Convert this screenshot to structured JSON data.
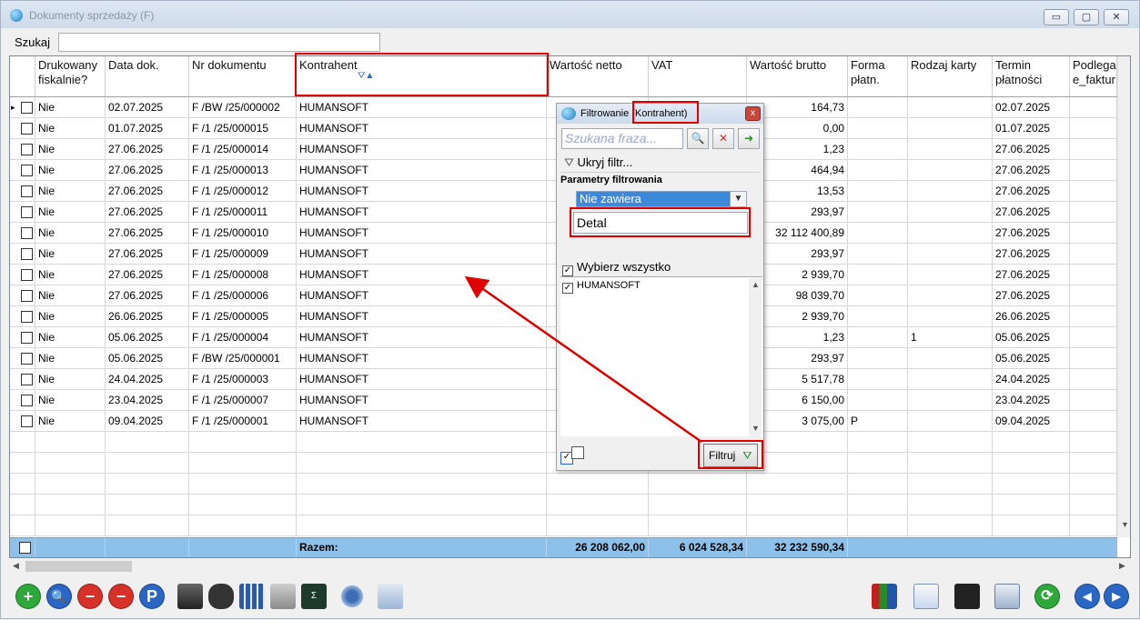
{
  "window": {
    "title": "Dokumenty sprzedaży (F)",
    "controls": {
      "minimize": "▭",
      "maximize": "▢",
      "close": "✕"
    }
  },
  "search": {
    "label": "Szukaj",
    "value": ""
  },
  "columns": [
    {
      "key": "drukowany",
      "label": "Drukowany\nfiskalnie?"
    },
    {
      "key": "data",
      "label": "Data dok."
    },
    {
      "key": "nr",
      "label": "Nr dokumentu"
    },
    {
      "key": "kontrahent",
      "label": "Kontrahent"
    },
    {
      "key": "netto",
      "label": "Wartość netto"
    },
    {
      "key": "vat",
      "label": "VAT"
    },
    {
      "key": "brutto",
      "label": "Wartość brutto"
    },
    {
      "key": "forma",
      "label": "Forma\npłatn."
    },
    {
      "key": "karta",
      "label": "Rodzaj karty"
    },
    {
      "key": "termin",
      "label": "Termin\npłatności"
    },
    {
      "key": "podlega",
      "label": "Podlega\ne_faktur"
    }
  ],
  "rows": [
    {
      "drukowany": "Nie",
      "data": "02.07.2025",
      "nr": "F /BW /25/000002",
      "kontrahent": "HUMANSOFT",
      "brutto": "164,73",
      "forma": "",
      "karta": "",
      "termin": "02.07.2025"
    },
    {
      "drukowany": "Nie",
      "data": "01.07.2025",
      "nr": "F /1  /25/000015",
      "kontrahent": "HUMANSOFT",
      "brutto": "0,00",
      "forma": "",
      "karta": "",
      "termin": "01.07.2025"
    },
    {
      "drukowany": "Nie",
      "data": "27.06.2025",
      "nr": "F /1  /25/000014",
      "kontrahent": "HUMANSOFT",
      "brutto": "1,23",
      "forma": "",
      "karta": "",
      "termin": "27.06.2025"
    },
    {
      "drukowany": "Nie",
      "data": "27.06.2025",
      "nr": "F /1  /25/000013",
      "kontrahent": "HUMANSOFT",
      "brutto": "464,94",
      "forma": "",
      "karta": "",
      "termin": "27.06.2025"
    },
    {
      "drukowany": "Nie",
      "data": "27.06.2025",
      "nr": "F /1  /25/000012",
      "kontrahent": "HUMANSOFT",
      "brutto": "13,53",
      "forma": "",
      "karta": "",
      "termin": "27.06.2025"
    },
    {
      "drukowany": "Nie",
      "data": "27.06.2025",
      "nr": "F /1  /25/000011",
      "kontrahent": "HUMANSOFT",
      "brutto": "293,97",
      "forma": "",
      "karta": "",
      "termin": "27.06.2025"
    },
    {
      "drukowany": "Nie",
      "data": "27.06.2025",
      "nr": "F /1  /25/000010",
      "kontrahent": "HUMANSOFT",
      "brutto": "32 112 400,89",
      "forma": "",
      "karta": "",
      "termin": "27.06.2025"
    },
    {
      "drukowany": "Nie",
      "data": "27.06.2025",
      "nr": "F /1  /25/000009",
      "kontrahent": "HUMANSOFT",
      "brutto": "293,97",
      "forma": "",
      "karta": "",
      "termin": "27.06.2025"
    },
    {
      "drukowany": "Nie",
      "data": "27.06.2025",
      "nr": "F /1  /25/000008",
      "kontrahent": "HUMANSOFT",
      "brutto": "2 939,70",
      "forma": "",
      "karta": "",
      "termin": "27.06.2025"
    },
    {
      "drukowany": "Nie",
      "data": "27.06.2025",
      "nr": "F /1  /25/000006",
      "kontrahent": "HUMANSOFT",
      "brutto": "98 039,70",
      "forma": "",
      "karta": "",
      "termin": "27.06.2025"
    },
    {
      "drukowany": "Nie",
      "data": "26.06.2025",
      "nr": "F /1  /25/000005",
      "kontrahent": "HUMANSOFT",
      "brutto": "2 939,70",
      "forma": "",
      "karta": "",
      "termin": "26.06.2025"
    },
    {
      "drukowany": "Nie",
      "data": "05.06.2025",
      "nr": "F /1  /25/000004",
      "kontrahent": "HUMANSOFT",
      "brutto": "1,23",
      "forma": "",
      "karta": "1",
      "termin": "05.06.2025"
    },
    {
      "drukowany": "Nie",
      "data": "05.06.2025",
      "nr": "F /BW /25/000001",
      "kontrahent": "HUMANSOFT",
      "brutto": "293,97",
      "forma": "",
      "karta": "",
      "termin": "05.06.2025"
    },
    {
      "drukowany": "Nie",
      "data": "24.04.2025",
      "nr": "F /1  /25/000003",
      "kontrahent": "HUMANSOFT",
      "brutto": "5 517,78",
      "forma": "",
      "karta": "",
      "termin": "24.04.2025"
    },
    {
      "drukowany": "Nie",
      "data": "23.04.2025",
      "nr": "F /1  /25/000007",
      "kontrahent": "HUMANSOFT",
      "brutto": "6 150,00",
      "forma": "",
      "karta": "",
      "termin": "23.04.2025"
    },
    {
      "drukowany": "Nie",
      "data": "09.04.2025",
      "nr": "F /1  /25/000001",
      "kontrahent": "HUMANSOFT",
      "brutto": "3 075,00",
      "forma": "P",
      "karta": "",
      "termin": "09.04.2025"
    }
  ],
  "totals": {
    "label": "Razem:",
    "netto": "26 208 062,00",
    "vat": "6 024 528,34",
    "brutto": "32 232 590,34"
  },
  "dialog": {
    "title": "Filtrowanie (Kontrahent)",
    "close": "x",
    "search_placeholder": "Szukana fraza...",
    "hide_filter": "Ukryj filtr...",
    "params_label": "Parametry filtrowania",
    "condition": "Nie zawiera",
    "value": "Detal",
    "select_all": "Wybierz wszystko",
    "items": [
      "HUMANSOFT"
    ],
    "apply_button": "Filtruj"
  },
  "colors": {
    "accent": "#3d89d9",
    "footer": "#8dc1ea",
    "annotation": "#e00000"
  },
  "toolbar_icons": [
    "add-icon",
    "preview-icon",
    "delete-icon",
    "delete-marked-icon",
    "p-icon",
    "print-icon",
    "binoculars-icon",
    "table-icon",
    "sum-icon",
    "calculator-icon",
    "settings-icon",
    "export-icon",
    "chart-icon",
    "document-icon",
    "save-icon",
    "window-icon",
    "refresh-icon",
    "first-icon",
    "next-icon"
  ]
}
